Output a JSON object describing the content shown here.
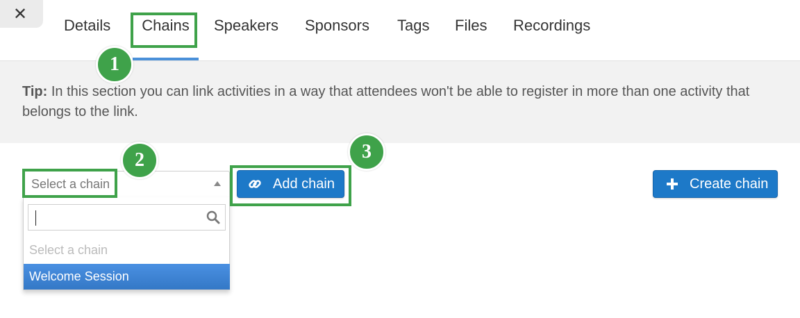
{
  "header": {
    "close_symbol": "✕"
  },
  "tabs": [
    {
      "label": "Details"
    },
    {
      "label": "Chains"
    },
    {
      "label": "Speakers"
    },
    {
      "label": "Sponsors"
    },
    {
      "label": "Tags"
    },
    {
      "label": "Files"
    },
    {
      "label": "Recordings"
    }
  ],
  "active_tab": "Chains",
  "tip": {
    "prefix": "Tip:",
    "text": "In this section you can link activities in a way that attendees won't be able to register in more than one activity that belongs to the link."
  },
  "chain_select": {
    "placeholder": "Select a chain",
    "search_value": "",
    "options": [
      {
        "label": "Select a chain",
        "placeholder": true
      },
      {
        "label": "Welcome Session",
        "selected": true
      }
    ],
    "search_icon": "search-icon",
    "arrow_icon": "triangle-up-icon"
  },
  "buttons": {
    "add_chain": {
      "label": "Add chain",
      "icon": "link-icon"
    },
    "create_chain": {
      "label": "Create chain",
      "icon": "plus-icon"
    }
  },
  "annotations": {
    "step_1": "1",
    "step_2": "2",
    "step_3": "3",
    "color": "#3fa24a"
  },
  "colors": {
    "primary_button": "#1d79c8",
    "tab_underline": "#4a90d9",
    "selected_option": "#3a83d6",
    "tip_background": "#f2f2f2"
  }
}
